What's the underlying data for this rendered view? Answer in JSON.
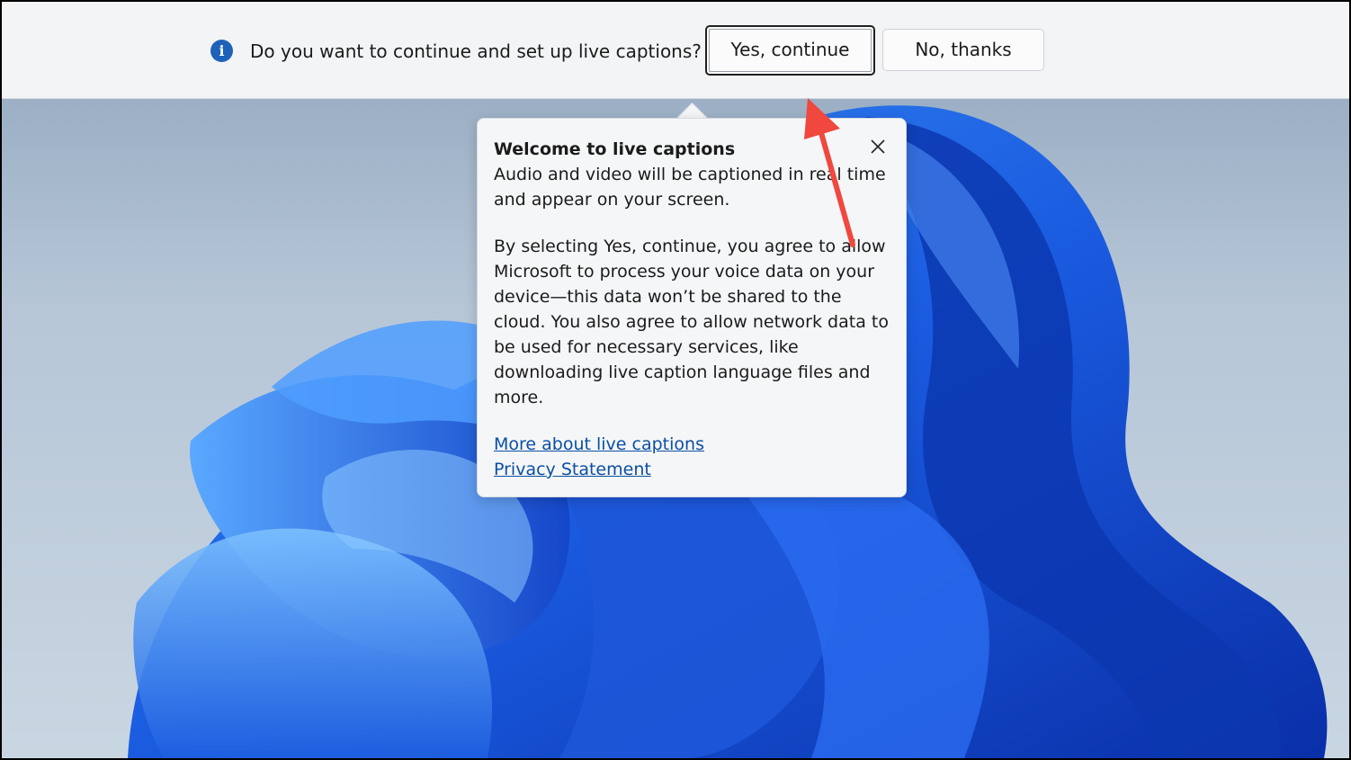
{
  "topbar": {
    "info_icon": "info-icon",
    "prompt_text": "Do you want to continue and set up live captions?",
    "yes_label": "Yes, continue",
    "no_label": "No, thanks"
  },
  "callout": {
    "title": "Welcome to live captions",
    "intro": "Audio and video will be captioned in real time and appear on your screen.",
    "consent": "By selecting Yes, continue, you agree to allow Microsoft to process your voice data on your device—this data won’t be shared to the cloud. You also agree to allow network data to be used for necessary services, like downloading live caption language files and more.",
    "link_more": "More about live captions",
    "link_privacy": "Privacy Statement",
    "close_icon": "close-icon"
  },
  "annotation": {
    "arrow_color": "#f0483e"
  },
  "colors": {
    "accent": "#1d62b8",
    "link": "#0b4fa3"
  }
}
